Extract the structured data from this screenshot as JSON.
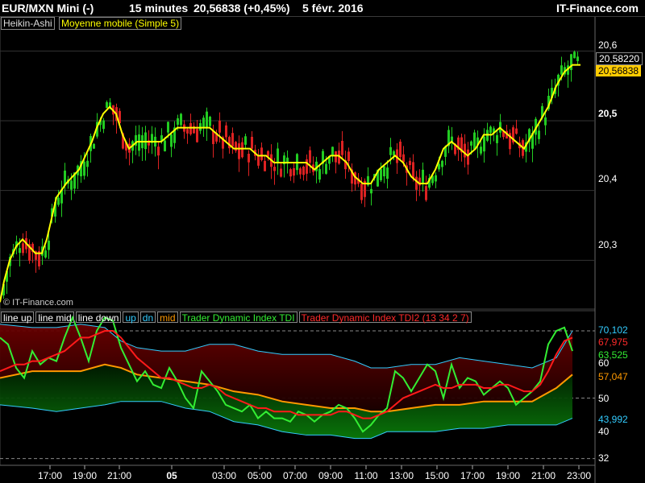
{
  "header": {
    "symbol": "EUR/MXN Mini (-)",
    "timeframe": "15 minutes",
    "last_price": "20,56838 (+0,45%)",
    "date": "5 févr. 2016",
    "brand": "IT-Finance.com"
  },
  "top_panel": {
    "legend_ha": "Heikin-Ashi",
    "legend_ma": "Moyenne mobile (Simple 5)",
    "watermark": "© IT-Finance.com",
    "y_ticks": [
      "20,6",
      "20,5",
      "20,4",
      "20,3"
    ],
    "tag_ma": "20,58220",
    "tag_price": "20,56838"
  },
  "bottom_panel": {
    "legend": [
      "line up",
      "line mid",
      "line down",
      "up",
      "dn",
      "mid",
      "Trader Dynamic Index TDI",
      "Trader Dynamic Index TDI2 (13 34 2 7)"
    ],
    "y_ticks": [
      "60",
      "50",
      "40",
      "32"
    ],
    "tags": {
      "up": "70,102",
      "tdi2": "67,975",
      "tdi": "63,525",
      "mid": "57,047",
      "down": "43,992"
    }
  },
  "x_axis": {
    "ticks": [
      "17:00",
      "19:00",
      "21:00",
      "05",
      "03:00",
      "05:00",
      "07:00",
      "09:00",
      "11:00",
      "13:00",
      "15:00",
      "17:00",
      "19:00",
      "21:00",
      "23:00"
    ]
  },
  "colors": {
    "bull": "#22cc22",
    "bear": "#dd2222",
    "ma": "#ffff00",
    "tdi": "#33ee33",
    "tdi2": "#ff1a1a",
    "mid": "#ff9900",
    "band": "#33ccff"
  },
  "chart_data": [
    {
      "type": "line",
      "title": "EUR/MXN Mini (-) 15 minutes",
      "ylim": [
        20.23,
        20.65
      ],
      "series": [
        {
          "name": "Moyenne mobile (Simple 5)",
          "x": [
            0,
            5,
            12,
            20,
            28,
            36,
            44,
            52,
            58,
            64,
            70,
            76,
            82,
            90,
            98,
            106,
            114,
            120,
            128,
            136,
            144,
            152,
            160,
            170,
            180,
            192,
            200,
            210,
            220,
            230,
            240,
            250,
            260,
            270,
            280,
            290,
            300,
            310,
            320,
            330,
            340,
            350,
            360,
            370,
            380,
            390,
            400,
            410,
            420,
            430,
            440,
            450,
            460,
            470,
            480,
            490,
            500,
            510,
            520,
            530,
            540,
            550,
            560,
            570,
            580,
            590,
            600,
            610,
            620,
            630,
            640,
            650,
            660,
            670,
            680,
            690,
            700,
            710,
            720
          ],
          "values": [
            20.24,
            20.27,
            20.3,
            20.32,
            20.33,
            20.32,
            20.31,
            20.31,
            20.33,
            20.36,
            20.39,
            20.4,
            20.41,
            20.42,
            20.43,
            20.45,
            20.47,
            20.49,
            20.51,
            20.52,
            20.51,
            20.48,
            20.46,
            20.47,
            20.47,
            20.47,
            20.47,
            20.48,
            20.49,
            20.49,
            20.49,
            20.49,
            20.49,
            20.48,
            20.47,
            20.46,
            20.46,
            20.46,
            20.45,
            20.45,
            20.44,
            20.44,
            20.44,
            20.44,
            20.44,
            20.43,
            20.44,
            20.45,
            20.45,
            20.44,
            20.42,
            20.41,
            20.41,
            20.43,
            20.44,
            20.45,
            20.44,
            20.42,
            20.41,
            20.41,
            20.43,
            20.46,
            20.47,
            20.46,
            20.45,
            20.46,
            20.48,
            20.48,
            20.49,
            20.48,
            20.47,
            20.46,
            20.48,
            20.5,
            20.52,
            20.55,
            20.57,
            20.58,
            20.58
          ]
        }
      ]
    },
    {
      "type": "line",
      "title": "Trader Dynamic Index TDI",
      "ylim": [
        30,
        76
      ],
      "series": [
        {
          "name": "line up",
          "x": [
            0,
            40,
            70,
            100,
            130,
            150,
            170,
            200,
            230,
            260,
            290,
            320,
            350,
            380,
            410,
            440,
            460,
            480,
            510,
            540,
            570,
            600,
            630,
            660,
            690,
            710
          ],
          "values": [
            72,
            71,
            71,
            72,
            71,
            67,
            65,
            64,
            64,
            66,
            66,
            64,
            63,
            63,
            63,
            61,
            59,
            59,
            60,
            60,
            62,
            61,
            60,
            59,
            62,
            70
          ]
        },
        {
          "name": "line mid",
          "x": [
            0,
            40,
            70,
            100,
            130,
            150,
            170,
            200,
            230,
            260,
            290,
            320,
            350,
            380,
            410,
            440,
            460,
            480,
            510,
            540,
            570,
            600,
            630,
            660,
            690,
            710
          ],
          "values": [
            56,
            58,
            58,
            58,
            60,
            59,
            57,
            56,
            55,
            54,
            52,
            51,
            49,
            48,
            47,
            47,
            46,
            46,
            47,
            48,
            48,
            49,
            49,
            49,
            53,
            57
          ]
        },
        {
          "name": "line down",
          "x": [
            0,
            40,
            70,
            100,
            130,
            150,
            170,
            200,
            230,
            260,
            290,
            320,
            350,
            380,
            410,
            440,
            460,
            480,
            510,
            540,
            570,
            600,
            630,
            660,
            690,
            710
          ],
          "values": [
            48,
            47,
            46,
            47,
            48,
            49,
            49,
            49,
            47,
            46,
            43,
            42,
            40,
            39,
            39,
            38,
            38,
            40,
            40,
            40,
            41,
            41,
            42,
            42,
            42,
            44
          ]
        },
        {
          "name": "Trader Dynamic Index TDI",
          "x": [
            0,
            10,
            20,
            30,
            40,
            50,
            60,
            70,
            80,
            90,
            100,
            110,
            120,
            130,
            140,
            150,
            160,
            170,
            180,
            190,
            200,
            210,
            220,
            230,
            240,
            250,
            260,
            270,
            280,
            290,
            300,
            310,
            320,
            330,
            340,
            350,
            360,
            370,
            380,
            390,
            400,
            410,
            420,
            430,
            440,
            450,
            460,
            470,
            480,
            490,
            500,
            510,
            520,
            530,
            540,
            550,
            560,
            570,
            580,
            590,
            600,
            610,
            620,
            630,
            640,
            650,
            660,
            670,
            680,
            690,
            700,
            710
          ],
          "values": [
            68,
            66,
            59,
            56,
            64,
            60,
            62,
            61,
            68,
            74,
            68,
            61,
            70,
            74,
            73,
            65,
            60,
            55,
            58,
            54,
            53,
            59,
            55,
            50,
            47,
            58,
            55,
            52,
            48,
            47,
            46,
            48,
            44,
            46,
            44,
            44,
            43,
            46,
            45,
            43,
            45,
            46,
            48,
            47,
            44,
            40,
            42,
            45,
            47,
            58,
            56,
            52,
            56,
            60,
            58,
            50,
            60,
            53,
            56,
            55,
            51,
            53,
            55,
            53,
            48,
            50,
            52,
            55,
            66,
            70,
            71,
            64
          ]
        },
        {
          "name": "Trader Dynamic Index TDI2 (13 34 2 7)",
          "x": [
            0,
            10,
            20,
            30,
            40,
            50,
            60,
            70,
            80,
            90,
            100,
            110,
            120,
            130,
            140,
            150,
            160,
            170,
            180,
            190,
            200,
            210,
            220,
            230,
            240,
            250,
            260,
            270,
            280,
            290,
            300,
            310,
            320,
            330,
            340,
            350,
            360,
            370,
            380,
            390,
            400,
            410,
            420,
            430,
            440,
            450,
            460,
            470,
            480,
            490,
            500,
            510,
            520,
            530,
            540,
            550,
            560,
            570,
            580,
            590,
            600,
            610,
            620,
            630,
            640,
            650,
            660,
            670,
            680,
            690,
            700,
            710
          ],
          "values": [
            58,
            59,
            60,
            60,
            61,
            61,
            62,
            63,
            64,
            66,
            68,
            68,
            69,
            70,
            70,
            68,
            65,
            62,
            60,
            58,
            56,
            56,
            55,
            54,
            53,
            53,
            54,
            53,
            51,
            50,
            49,
            48,
            47,
            47,
            46,
            46,
            46,
            45,
            45,
            45,
            45,
            45,
            46,
            46,
            45,
            44,
            44,
            45,
            46,
            48,
            50,
            51,
            52,
            53,
            54,
            53,
            53,
            54,
            54,
            54,
            53,
            53,
            54,
            54,
            53,
            52,
            52,
            54,
            58,
            63,
            67,
            68
          ]
        }
      ]
    }
  ]
}
